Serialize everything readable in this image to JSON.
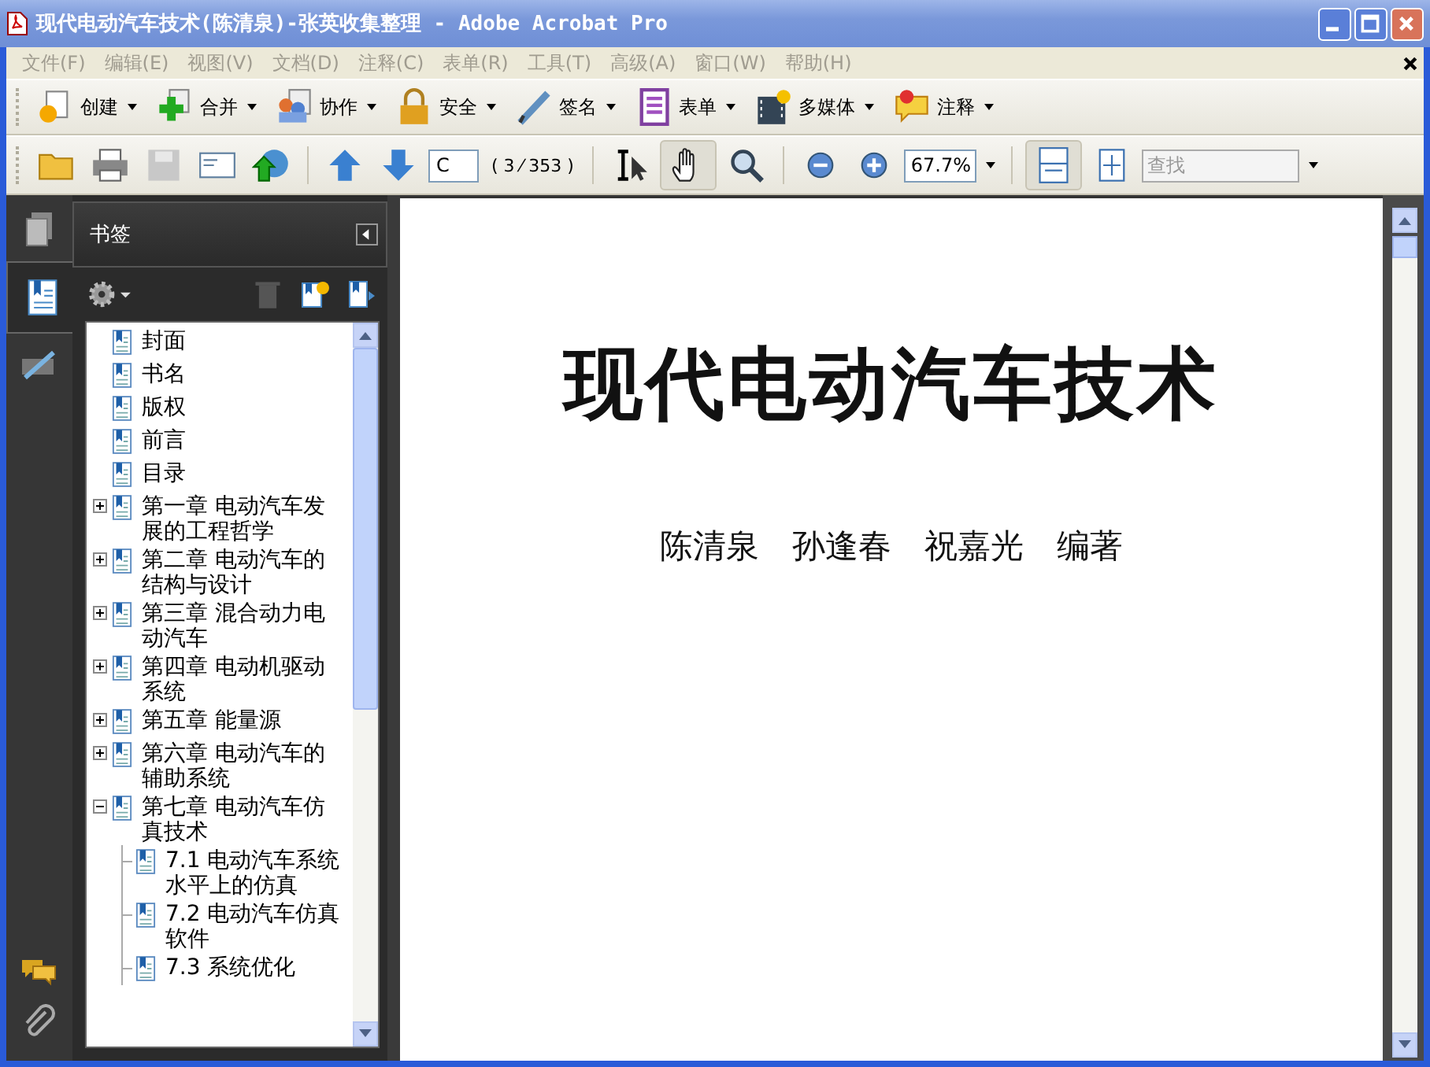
{
  "window": {
    "title": "现代电动汽车技术(陈清泉)-张英收集整理 - Adobe Acrobat Pro"
  },
  "menu": [
    "文件(F)",
    "编辑(E)",
    "视图(V)",
    "文档(D)",
    "注释(C)",
    "表单(R)",
    "工具(T)",
    "高级(A)",
    "窗口(W)",
    "帮助(H)"
  ],
  "task_toolbar": [
    {
      "kind": "create",
      "label": "创建"
    },
    {
      "kind": "combine",
      "label": "合并"
    },
    {
      "kind": "collaborate",
      "label": "协作"
    },
    {
      "kind": "secure",
      "label": "安全"
    },
    {
      "kind": "sign",
      "label": "签名"
    },
    {
      "kind": "forms",
      "label": "表单"
    },
    {
      "kind": "multimedia",
      "label": "多媒体"
    },
    {
      "kind": "comment",
      "label": "注释"
    }
  ],
  "nav_toolbar": {
    "page_field": "C",
    "page_count": "( 3 ⁄ 353 )",
    "zoom": "67.7%",
    "search": {
      "placeholder": "查找"
    }
  },
  "bookmarks": {
    "title": "书签",
    "items": [
      {
        "label": "封面"
      },
      {
        "label": "书名"
      },
      {
        "label": "版权"
      },
      {
        "label": "前言"
      },
      {
        "label": "目录"
      },
      {
        "label": "第一章 电动汽车发展的工程哲学",
        "expanded": false
      },
      {
        "label": "第二章 电动汽车的结构与设计",
        "expanded": false
      },
      {
        "label": "第三章 混合动力电动汽车",
        "expanded": false
      },
      {
        "label": "第四章 电动机驱动系统",
        "expanded": false
      },
      {
        "label": "第五章 能量源",
        "expanded": false
      },
      {
        "label": "第六章 电动汽车的辅助系统",
        "expanded": false
      },
      {
        "label": "第七章 电动汽车仿真技术",
        "expanded": true,
        "children": [
          {
            "label": "7.1 电动汽车系统水平上的仿真"
          },
          {
            "label": "7.2 电动汽车仿真软件"
          },
          {
            "label": "7.3 系统优化"
          }
        ]
      }
    ]
  },
  "document": {
    "title": "现代电动汽车技术",
    "authors": "陈清泉　孙逢春　祝嘉光　编著"
  }
}
